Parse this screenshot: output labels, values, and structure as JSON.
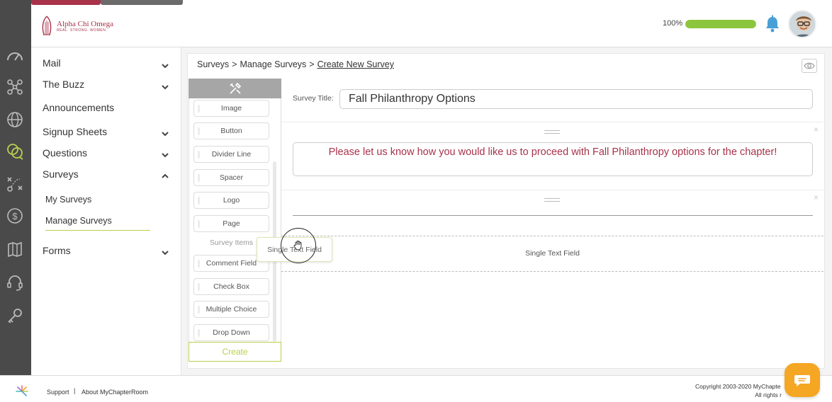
{
  "header": {
    "brand_name": "Alpha Chi Omega",
    "brand_tagline": "REAL. STRONG. WOMEN.",
    "progress_text": "100%",
    "progress_value": 1.0,
    "progress_color": "#8cc63f",
    "notification_icon": "bell-icon"
  },
  "rail": {
    "icons": [
      "dashboard-gauge-icon",
      "network-icon",
      "globe-icon",
      "chat-bubbles-icon",
      "strategy-icon",
      "dollar-icon",
      "map-book-icon",
      "headset-icon",
      "key-icon"
    ]
  },
  "sidebar": {
    "items": [
      {
        "label": "Mail",
        "expanded": false
      },
      {
        "label": "The Buzz",
        "expanded": false
      },
      {
        "label": "Announcements"
      },
      {
        "label": "Signup Sheets",
        "expanded": false
      },
      {
        "label": "Questions",
        "expanded": false
      },
      {
        "label": "Surveys",
        "expanded": true
      },
      {
        "label": "Forms",
        "expanded": false
      }
    ],
    "subitems": [
      {
        "label": "My Surveys"
      },
      {
        "label": "Manage Surveys",
        "active": true
      }
    ]
  },
  "breadcrumb": {
    "items": [
      "Surveys",
      "Manage Surveys",
      "Create New Survey"
    ],
    "separator": ">"
  },
  "palette": {
    "header_icon": "tools-icon",
    "tools": [
      "Image",
      "Button",
      "Divider Line",
      "Spacer",
      "Logo",
      "Page"
    ],
    "section_label": "Survey Items",
    "survey_items": [
      "Comment Field",
      "Check Box",
      "Multiple Choice",
      "Drop Down"
    ],
    "create_label": "Create"
  },
  "form": {
    "title_label": "Survey Title:",
    "title_value": "Fall Philanthropy Options",
    "message": "Please let us know how you would like us to proceed with Fall Philanthropy options for the chapter!",
    "drop_zone_label": "Single Text Field",
    "drag_item_label": "Single Text Field"
  },
  "footer": {
    "links": [
      "Support",
      "About MyChapterRoom"
    ],
    "link_separator": "|",
    "copyright_line1": "Copyright 2003-2020 MyChapte",
    "copyright_line2": "All rights r"
  },
  "colors": {
    "brand": "#a8324a",
    "accent": "#b8cf4e",
    "rail": "#4a4a4a",
    "chat": "#f5a623"
  }
}
